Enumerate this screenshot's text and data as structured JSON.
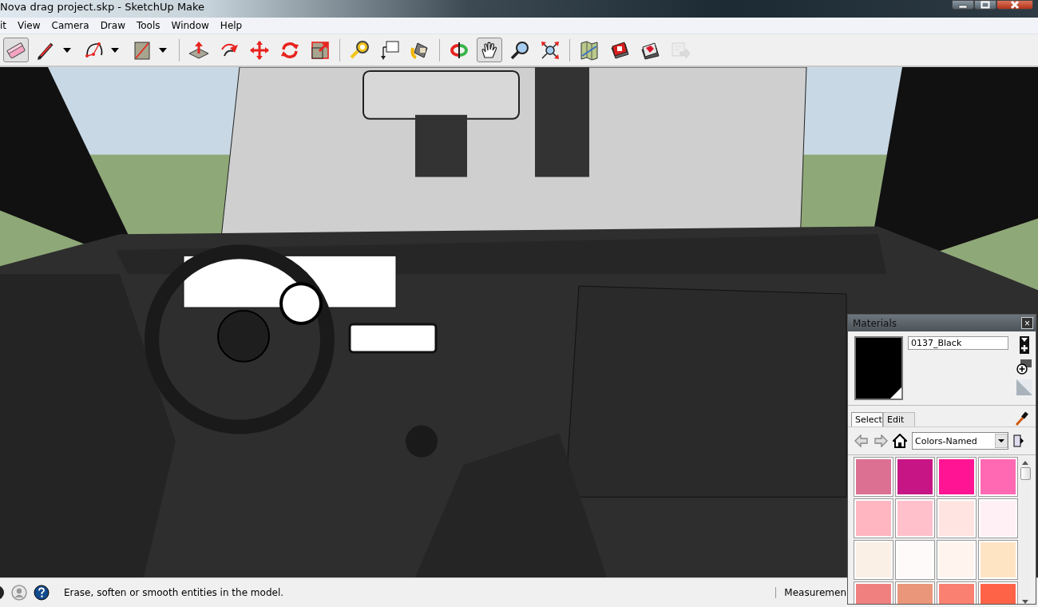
{
  "window": {
    "title": "Nova drag project.skp - SketchUp Make"
  },
  "menu": [
    "it",
    "View",
    "Camera",
    "Draw",
    "Tools",
    "Window",
    "Help"
  ],
  "toolbar": [
    {
      "kind": "tool",
      "selected": true,
      "disabled": false
    },
    {
      "kind": "split",
      "selected": false,
      "disabled": false
    },
    {
      "kind": "split",
      "selected": false,
      "disabled": false
    },
    {
      "kind": "split",
      "selected": false,
      "disabled": false
    },
    {
      "kind": "separator"
    },
    {
      "kind": "tool",
      "selected": false,
      "disabled": false
    },
    {
      "kind": "tool",
      "selected": false,
      "disabled": false
    },
    {
      "kind": "tool",
      "selected": false,
      "disabled": false
    },
    {
      "kind": "tool",
      "selected": false,
      "disabled": false
    },
    {
      "kind": "tool",
      "selected": false,
      "disabled": false
    },
    {
      "kind": "separator"
    },
    {
      "kind": "tool",
      "selected": false,
      "disabled": false
    },
    {
      "kind": "tool",
      "selected": false,
      "disabled": false
    },
    {
      "kind": "tool",
      "selected": false,
      "disabled": false
    },
    {
      "kind": "separator"
    },
    {
      "kind": "tool",
      "selected": false,
      "disabled": false
    },
    {
      "kind": "tool",
      "selected": true,
      "disabled": false
    },
    {
      "kind": "tool",
      "selected": false,
      "disabled": false
    },
    {
      "kind": "tool",
      "selected": false,
      "disabled": false
    },
    {
      "kind": "separator"
    },
    {
      "kind": "tool",
      "selected": false,
      "disabled": false
    },
    {
      "kind": "tool",
      "selected": false,
      "disabled": false
    },
    {
      "kind": "tool",
      "selected": false,
      "disabled": false
    },
    {
      "kind": "tool",
      "selected": false,
      "disabled": true
    }
  ],
  "status_bar": {
    "hint": "Erase, soften or smooth entities in the model.",
    "measurements_label": "Measuremen"
  },
  "materials": {
    "title": "Materials",
    "close": "×",
    "material_name": "0137_Black",
    "tabs": [
      {
        "label": "Select",
        "selected": true
      },
      {
        "label": "Edit",
        "selected": false
      }
    ],
    "library": "Colors-Named",
    "swatches": [
      {
        "color": "#db7093"
      },
      {
        "color": "#c71585"
      },
      {
        "color": "#ff1493"
      },
      {
        "color": "#ff69b4"
      },
      {
        "color": "#ffb6c1"
      },
      {
        "color": "#ffc0cb"
      },
      {
        "color": "#ffe4e1"
      },
      {
        "color": "#fff0f5"
      },
      {
        "color": "#faf0e6"
      },
      {
        "color": "#fffafa"
      },
      {
        "color": "#fff5ee"
      },
      {
        "color": "#ffe4c4"
      },
      {
        "color": "#f08080"
      },
      {
        "color": "#e9967a"
      },
      {
        "color": "#fa8072"
      },
      {
        "color": "#ff6347"
      }
    ]
  }
}
